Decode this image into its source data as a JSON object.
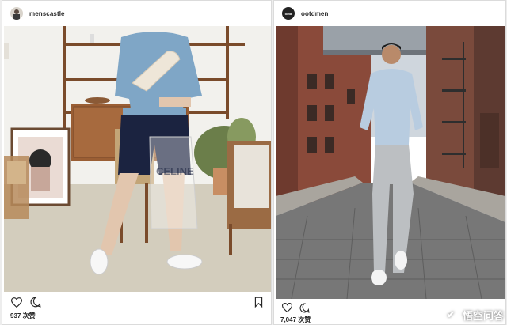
{
  "posts": [
    {
      "username": "menscastle",
      "likes_text": "937 次赞",
      "icons": [
        "heart-icon",
        "comment-icon",
        "bookmark-icon"
      ]
    },
    {
      "username": "ootdmen",
      "avatar_text": "ootd",
      "likes_text": "7,047 次赞",
      "icons": [
        "heart-icon",
        "comment-icon"
      ]
    }
  ],
  "photo_text": {
    "bag_print": "CELINE"
  },
  "watermark": {
    "text": "悟空问答",
    "logo_glyph": "✔"
  },
  "colors": {
    "shirt1": "#7fa6c6",
    "shorts": "#1b2340",
    "wall": "#f2f1ed",
    "street": "#777777",
    "brick": "#8a4a3a"
  }
}
